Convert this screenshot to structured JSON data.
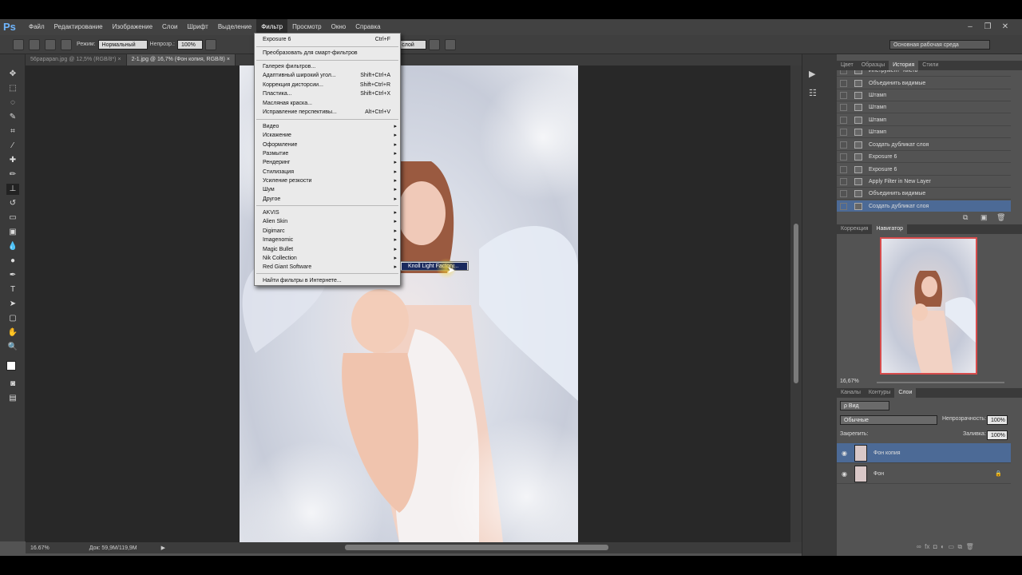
{
  "app": {
    "logo": "Ps"
  },
  "menubar": {
    "items": [
      "Файл",
      "Редактирование",
      "Изображение",
      "Слои",
      "Шрифт",
      "Выделение",
      "Фильтр",
      "Просмотр",
      "Окно",
      "Справка"
    ],
    "active_index": 6,
    "window_buttons": [
      "–",
      "❐",
      "✕"
    ]
  },
  "options": {
    "mode_label": "Режим:",
    "mode_value": "Нормальный",
    "opacity_label": "Непрозр.:",
    "opacity_value": "100%",
    "sample_value": "...вный слой",
    "workspace_value": "Основная рабочая среда"
  },
  "doc_tabs": [
    {
      "label": "56papapan.jpg @ 12,5% (RGB/8*)",
      "close": "×"
    },
    {
      "label": "2-1.jpg @ 16,7% (Фон копия, RGB/8)",
      "close": "×"
    }
  ],
  "status": {
    "zoom": "16.67%",
    "doc": "Док: 59,9M/119,9M",
    "arrow": "▶"
  },
  "filter_menu": {
    "items": [
      {
        "label": "Exposure 6",
        "shortcut": "Ctrl+F"
      },
      {
        "label": "Преобразовать для смарт-фильтров",
        "shortcut": ""
      },
      {
        "label": "Галерея фильтров...",
        "shortcut": ""
      },
      {
        "label": "Адаптивный широкий угол...",
        "shortcut": "Shift+Ctrl+A"
      },
      {
        "label": "Коррекция дисторсии...",
        "shortcut": "Shift+Ctrl+R"
      },
      {
        "label": "Пластика...",
        "shortcut": "Shift+Ctrl+X"
      },
      {
        "label": "Масляная краска...",
        "shortcut": ""
      },
      {
        "label": "Исправление перспективы...",
        "shortcut": "Alt+Ctrl+V"
      },
      {
        "label": "Видео",
        "arrow": "▸"
      },
      {
        "label": "Искажение",
        "arrow": "▸"
      },
      {
        "label": "Оформление",
        "arrow": "▸"
      },
      {
        "label": "Размытие",
        "arrow": "▸"
      },
      {
        "label": "Рендеринг",
        "arrow": "▸"
      },
      {
        "label": "Стилизация",
        "arrow": "▸"
      },
      {
        "label": "Усиление резкости",
        "arrow": "▸"
      },
      {
        "label": "Шум",
        "arrow": "▸"
      },
      {
        "label": "Другое",
        "arrow": "▸"
      },
      {
        "label": "AKVIS",
        "arrow": "▸"
      },
      {
        "label": "Alien Skin",
        "arrow": "▸"
      },
      {
        "label": "Digimarc",
        "arrow": "▸"
      },
      {
        "label": "Imagenomic",
        "arrow": "▸"
      },
      {
        "label": "Magic Bullet",
        "arrow": "▸"
      },
      {
        "label": "Nik Collection",
        "arrow": "▸"
      },
      {
        "label": "Red Giant Software",
        "arrow": "▸"
      },
      {
        "label": "Найти фильтры в Интернете...",
        "shortcut": ""
      }
    ],
    "submenu_item": "Knoll Light Factory..."
  },
  "history_panel": {
    "tabs": [
      "Цвет",
      "Образцы",
      "История",
      "Стили"
    ],
    "active_tab": 2,
    "rows": [
      "Инструмент \"Кисть\"",
      "Объединить видимые",
      "Штамп",
      "Штамп",
      "Штамп",
      "Штамп",
      "Создать дубликат слоя",
      "Exposure 6",
      "Exposure 6",
      "Apply Filter in New Layer",
      "Объединить видимые",
      "Создать дубликат слоя"
    ],
    "selected_row": 11
  },
  "navigator_panel": {
    "tabs": [
      "Коррекция",
      "Навигатор"
    ],
    "active_tab": 1,
    "zoom": "16,67%"
  },
  "layers_panel": {
    "tabs": [
      "Каналы",
      "Контуры",
      "Слои"
    ],
    "active_tab": 2,
    "kind_value": "ρ Вид",
    "blend_value": "Обычные",
    "opacity_label": "Непрозрачность:",
    "opacity_value": "100%",
    "lock_label": "Закрепить:",
    "fill_label": "Заливка:",
    "fill_value": "100%",
    "layers": [
      {
        "name": "Фон копия",
        "selected": true
      },
      {
        "name": "Фон",
        "selected": false,
        "locked": "🔒"
      }
    ]
  }
}
